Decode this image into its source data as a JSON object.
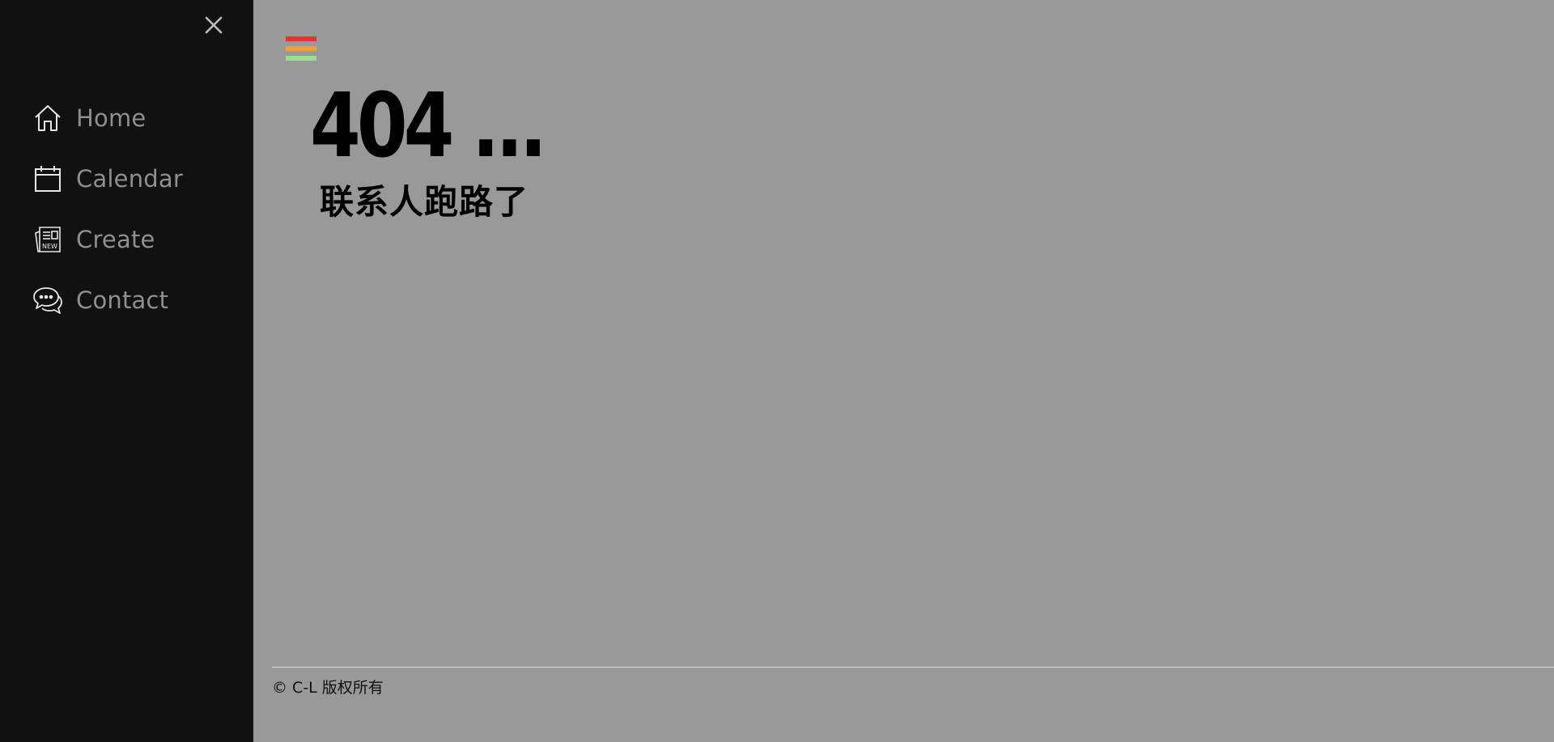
{
  "sidebar": {
    "close_icon": "close-icon",
    "items": [
      {
        "label": "Home",
        "icon": "home-icon"
      },
      {
        "label": "Calendar",
        "icon": "calendar-icon"
      },
      {
        "label": "Create",
        "icon": "newspaper-icon"
      },
      {
        "label": "Contact",
        "icon": "chat-bubbles-icon"
      }
    ]
  },
  "main": {
    "menu_icon": "hamburger-icon",
    "menu_colors": [
      "#e8322e",
      "#f0a03a",
      "#9be08e"
    ],
    "error_code": "404 ...",
    "message": "联系人跑路了"
  },
  "footer": {
    "copyright": "© C-L 版权所有"
  },
  "colors": {
    "sidebar_bg": "#111111",
    "main_bg": "#999999",
    "nav_text": "#8f8f8f"
  }
}
